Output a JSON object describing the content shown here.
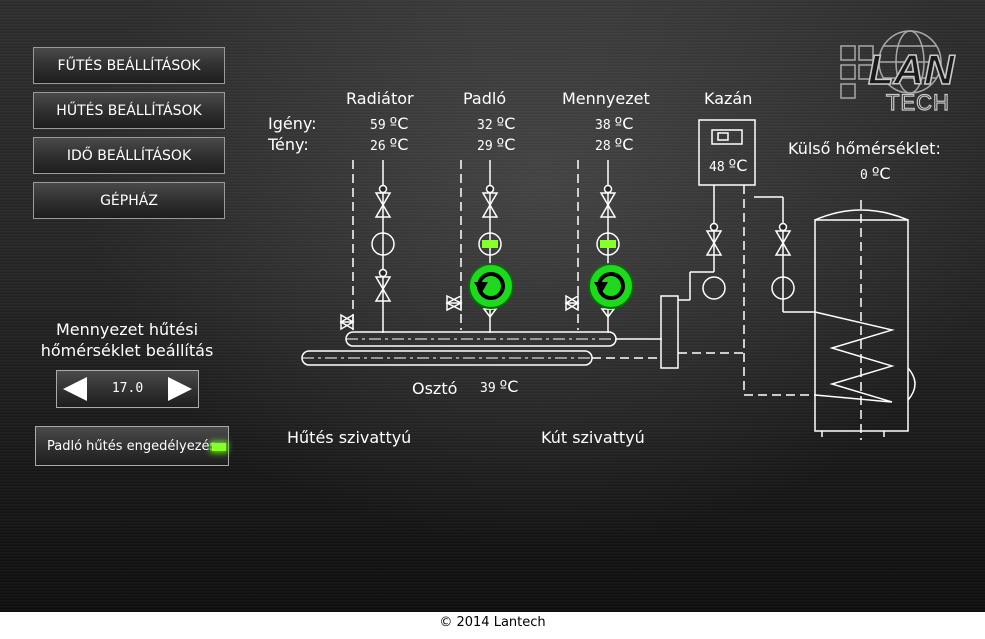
{
  "nav": {
    "heating_settings": "FŰTÉS BEÁLLÍTÁSOK",
    "cooling_settings": "HŰTÉS BEÁLLÍTÁSOK",
    "time_settings": "IDŐ BEÁLLÍTÁSOK",
    "engine_room": "GÉPHÁZ"
  },
  "row_labels": {
    "demand": "Igény:",
    "actual": "Tény:"
  },
  "circuits": [
    {
      "name": "Radiátor",
      "demand": "59",
      "actual": "26",
      "pump_active": false
    },
    {
      "name": "Padló",
      "demand": "32",
      "actual": "29",
      "pump_active": true
    },
    {
      "name": "Mennyezet",
      "demand": "38",
      "actual": "28",
      "pump_active": true
    }
  ],
  "unit": "ºC",
  "boiler": {
    "name": "Kazán",
    "temp": "48"
  },
  "outdoor": {
    "label": "Külső hőmérséklet:",
    "temp": "0"
  },
  "distributor": {
    "label": "Osztó",
    "temp": "39"
  },
  "pumps": {
    "cooling_pump": "Hűtés szivattyú",
    "well_pump": "Kút szivattyú"
  },
  "ceiling_cooling": {
    "title_line1": "Mennyezet hűtési",
    "title_line2": "hőmérséklet beállítás",
    "value": "17.0"
  },
  "floor_cooling": {
    "label": "Padló hűtés engedélyezés",
    "enabled": true
  },
  "logo": {
    "text_top": "LAN",
    "text_bottom": "TECH"
  },
  "footer": "© 2014 Lantech",
  "colors": {
    "active_pump": "#1fd81f",
    "led": "#86ff2a",
    "background": "#262626"
  }
}
